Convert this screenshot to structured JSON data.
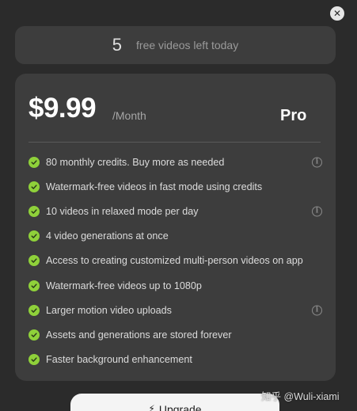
{
  "close_symbol": "✕",
  "credits": {
    "count": "5",
    "label": "free videos left today"
  },
  "plan": {
    "price": "$9.99",
    "period": "/Month",
    "name": "Pro"
  },
  "features": [
    {
      "text": "80 monthly credits. Buy more as needed",
      "info": true
    },
    {
      "text": "Watermark-free videos in fast mode using credits",
      "info": false
    },
    {
      "text": "10 videos in relaxed mode per day",
      "info": true
    },
    {
      "text": "4 video generations at once",
      "info": false
    },
    {
      "text": "Access to creating customized multi-person videos on app",
      "info": false
    },
    {
      "text": "Watermark-free videos up to 1080p",
      "info": false
    },
    {
      "text": "Larger motion video uploads",
      "info": true
    },
    {
      "text": "Assets and generations are stored forever",
      "info": false
    },
    {
      "text": "Faster background enhancement",
      "info": false
    }
  ],
  "info_symbol": "i",
  "upgrade": {
    "icon": "⚡",
    "label": "Upgrade"
  },
  "watermark": "知乎 @Wuli-xiami",
  "colors": {
    "background": "#2b2b2b",
    "card": "#3d3d3d",
    "check": "#8fd13a",
    "button": "#f4f4f4"
  }
}
